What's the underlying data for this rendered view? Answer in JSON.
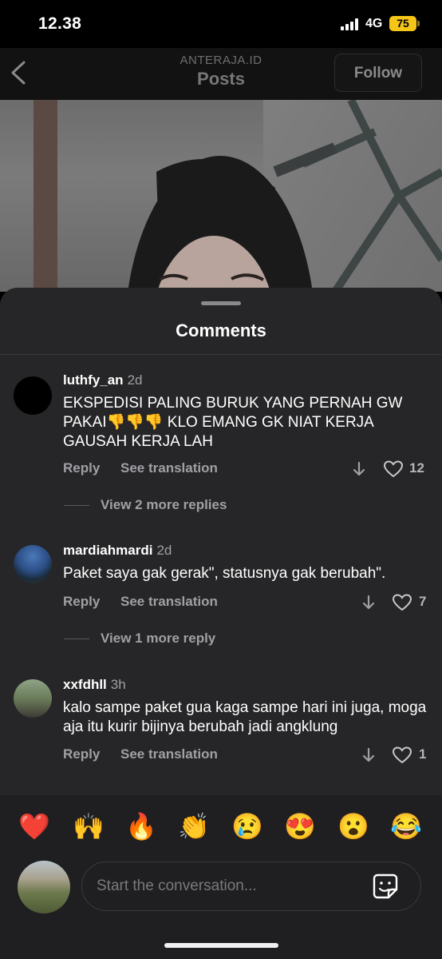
{
  "status_bar": {
    "time": "12.38",
    "network": "4G",
    "battery": "75"
  },
  "header": {
    "account": "ANTERAJA.ID",
    "title": "Posts",
    "follow_label": "Follow"
  },
  "comments_sheet": {
    "title": "Comments"
  },
  "comments": [
    {
      "username": "luthfy_an",
      "age": "2d",
      "text": "EKSPEDISI PALING BURUK YANG PERNAH GW PAKAI👎👎👎 KLO EMANG GK NIAT KERJA GAUSAH KERJA LAH",
      "reply_label": "Reply",
      "translate_label": "See translation",
      "likes": "12",
      "replies_label": "View 2 more replies"
    },
    {
      "username": "mardiahmardi",
      "age": "2d",
      "text": "Paket saya gak gerak\", statusnya gak berubah\".",
      "reply_label": "Reply",
      "translate_label": "See translation",
      "likes": "7",
      "replies_label": "View 1 more reply"
    },
    {
      "username": "xxfdhll",
      "age": "3h",
      "text": "kalo sampe paket gua kaga sampe hari ini juga, moga aja itu kurir bijinya berubah jadi angklung",
      "reply_label": "Reply",
      "translate_label": "See translation",
      "likes": "1"
    }
  ],
  "quick_reactions": [
    "❤️",
    "🙌",
    "🔥",
    "👏",
    "😢",
    "😍",
    "😮",
    "😂"
  ],
  "composer": {
    "placeholder": "Start the conversation..."
  },
  "colors": {
    "sheet_bg": "#262628",
    "muted_text": "#a0a0a5",
    "battery": "#f5c518"
  }
}
